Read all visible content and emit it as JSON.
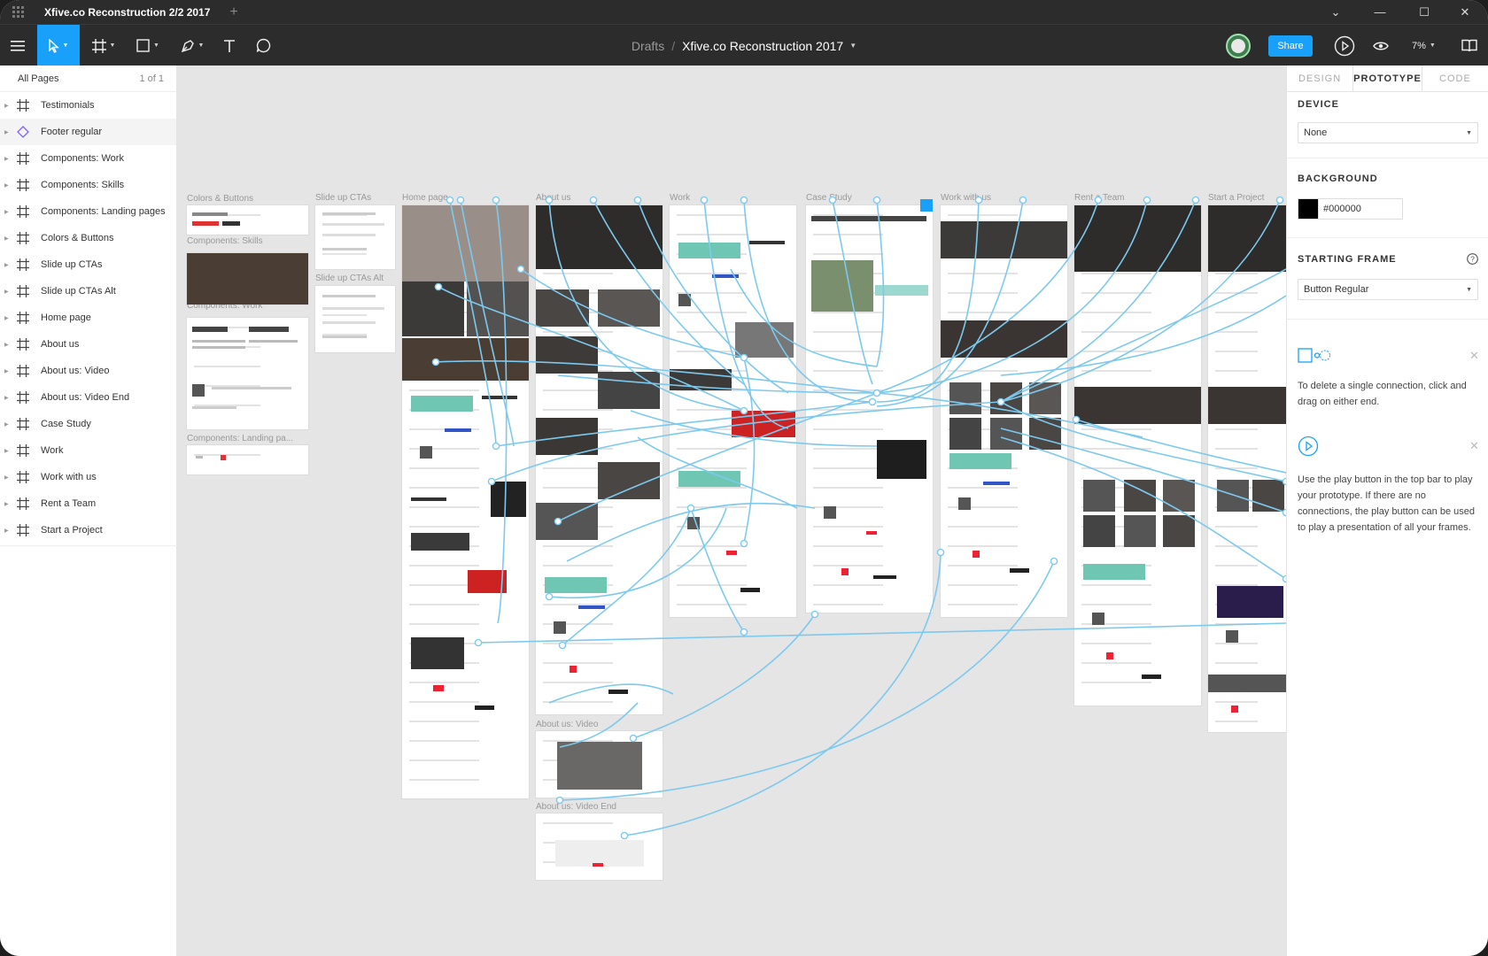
{
  "titlebar": {
    "file_tab": "Xfive.co Reconstruction 2/2 2017",
    "new_tab": "+",
    "minimize": "—",
    "maximize": "☐",
    "close": "✕",
    "dropdown": "⌄"
  },
  "toolbar": {
    "breadcrumb_drafts": "Drafts",
    "breadcrumb_sep": "/",
    "file_name": "Xfive.co Reconstruction 2017",
    "share_label": "Share",
    "zoom_label": "7%"
  },
  "pages": {
    "header": "All Pages",
    "count": "1 of 1"
  },
  "layers": [
    {
      "name": "Testimonials",
      "type": "frame"
    },
    {
      "name": "Footer regular",
      "type": "component"
    },
    {
      "name": "Components: Work",
      "type": "frame"
    },
    {
      "name": "Components: Skills",
      "type": "frame"
    },
    {
      "name": "Components: Landing pages",
      "type": "frame"
    },
    {
      "name": "Colors & Buttons",
      "type": "frame"
    },
    {
      "name": "Slide up CTAs",
      "type": "frame"
    },
    {
      "name": "Slide up CTAs Alt",
      "type": "frame"
    },
    {
      "name": "Home page",
      "type": "frame"
    },
    {
      "name": "About us",
      "type": "frame"
    },
    {
      "name": "About us: Video",
      "type": "frame"
    },
    {
      "name": "About us: Video End",
      "type": "frame"
    },
    {
      "name": "Case Study",
      "type": "frame"
    },
    {
      "name": "Work",
      "type": "frame"
    },
    {
      "name": "Work with us",
      "type": "frame"
    },
    {
      "name": "Rent a Team",
      "type": "frame"
    },
    {
      "name": "Start a Project",
      "type": "frame"
    }
  ],
  "canvas_labels": {
    "colors_buttons": "Colors & Buttons",
    "components_skills": "Components: Skills",
    "components_work": "Components: Work",
    "components_landing": "Components: Landing pa...",
    "slide_up_ctas": "Slide up CTAs",
    "slide_up_ctas_alt": "Slide up CTAs Alt",
    "home_page": "Home page",
    "about_us": "About us",
    "work": "Work",
    "case_study": "Case Study",
    "work_with_us": "Work with us",
    "rent_a_team": "Rent a Team",
    "start_a_project": "Start a Project",
    "about_us_video": "About us: Video",
    "about_us_video_end": "About us: Video End"
  },
  "right_panel": {
    "tabs": [
      "DESIGN",
      "PROTOTYPE",
      "CODE"
    ],
    "active_tab": "PROTOTYPE",
    "device_title": "DEVICE",
    "device_value": "None",
    "background_title": "BACKGROUND",
    "background_hex": "#000000",
    "background_color": "#000000",
    "starting_frame_title": "STARTING FRAME",
    "starting_frame_value": "Button Regular",
    "help_delete": "To delete a single connection, click and drag on either end.",
    "help_play": "Use the play button in the top bar to play your prototype. If there are no connections, the play button can be used to play a presentation of all your frames."
  },
  "colors": {
    "accent": "#18a0fb",
    "connection": "#7cc9ef",
    "toolbar_bg": "#2c2c2c",
    "canvas_bg": "#e5e5e5"
  }
}
